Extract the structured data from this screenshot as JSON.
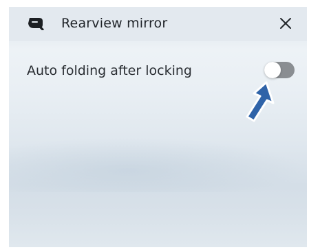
{
  "dialog": {
    "title": "Rearview mirror",
    "icon": "mirror-icon",
    "close_icon": "close-icon"
  },
  "settings": [
    {
      "label": "Auto folding after locking",
      "toggle_on": false
    }
  ],
  "annotation": {
    "icon": "arrow-pointer-icon",
    "color": "#2f63a8"
  },
  "colors": {
    "toggle_off": "#8a8e92",
    "text": "#1f2328"
  }
}
